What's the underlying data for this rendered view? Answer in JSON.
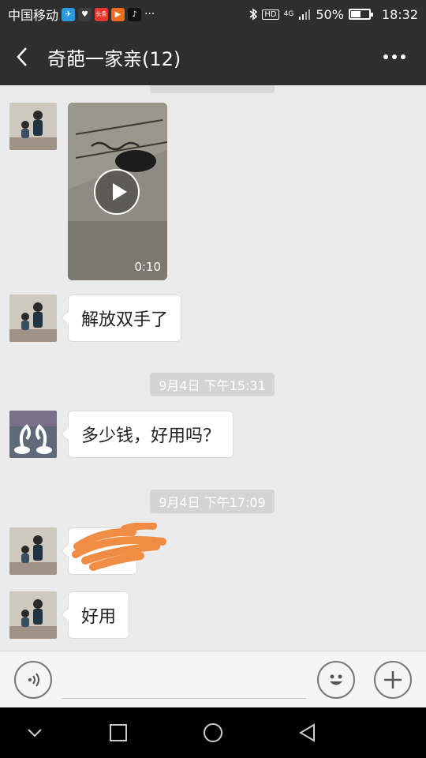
{
  "status_bar": {
    "carrier": "中国移动",
    "apps": [
      {
        "name": "telegram-app-icon",
        "color": "#2a9ae0",
        "glyph": "✈"
      },
      {
        "name": "health-app-icon",
        "color": "#3c3c3c",
        "glyph": "♥"
      },
      {
        "name": "toutiao-app-icon",
        "color": "#e8352f",
        "glyph": "头条"
      },
      {
        "name": "video-app-icon",
        "color": "#f06a1f",
        "glyph": "▶"
      },
      {
        "name": "tiktok-app-icon",
        "color": "#111111",
        "glyph": "♪"
      }
    ],
    "overflow": "···",
    "hd": "HD",
    "network": "4G",
    "battery_text": "50%",
    "battery_level": 0.5,
    "time": "18:32"
  },
  "header": {
    "back_icon": "chevron-left-icon",
    "title": "奇葩一家亲(12)",
    "more_icon": "more-horizontal-icon"
  },
  "messages": [
    {
      "type": "video",
      "duration": "0:10"
    },
    {
      "type": "text",
      "text": "解放双手了"
    },
    {
      "type": "timestamp",
      "text": "9月4日  下午15:31"
    },
    {
      "type": "text",
      "text": "多少钱，好用吗？"
    },
    {
      "type": "timestamp",
      "text": "9月4日  下午17:09"
    },
    {
      "type": "text",
      "text": "",
      "note": "redacted"
    },
    {
      "type": "text",
      "text": "好用"
    }
  ],
  "input_bar": {
    "voice_icon": "voice-icon",
    "emoji_icon": "emoji-icon",
    "plus_icon": "plus-icon"
  },
  "nav": {
    "down_icon": "chevron-down-icon",
    "recent_icon": "square-icon",
    "home_icon": "circle-icon",
    "back_icon": "triangle-back-icon"
  }
}
